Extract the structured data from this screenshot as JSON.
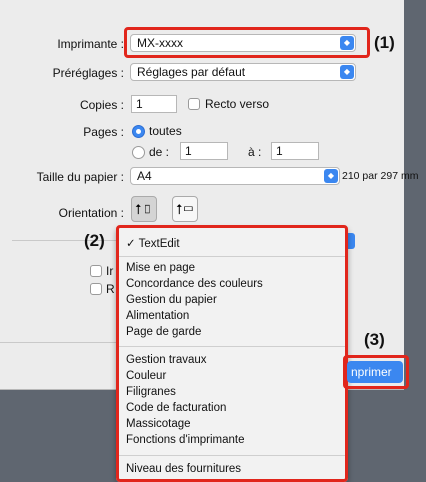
{
  "printer": {
    "label": "Imprimante :",
    "value": "MX-xxxx"
  },
  "presets": {
    "label": "Préréglages :",
    "value": "Réglages par défaut"
  },
  "copies": {
    "label": "Copies :",
    "value": "1",
    "duplex_label": "Recto verso"
  },
  "pages": {
    "label": "Pages :",
    "all_label": "toutes",
    "from_label": "de :",
    "from_value": "1",
    "to_label": "à :",
    "to_value": "1"
  },
  "paper": {
    "label": "Taille du papier :",
    "value": "A4",
    "dimensions": "210 par 297 mm"
  },
  "orientation": {
    "label": "Orientation :"
  },
  "callouts": {
    "c1": "(1)",
    "c2": "(2)",
    "c3": "(3)"
  },
  "hidden_options": {
    "opt1_fragment": "Ir",
    "opt2_fragment": "R"
  },
  "menu": {
    "checked": "✓ TextEdit",
    "group1": [
      "Mise en page",
      "Concordance des couleurs",
      "Gestion du papier",
      "Alimentation",
      "Page de garde"
    ],
    "group2": [
      "Gestion travaux",
      "Couleur",
      "Filigranes",
      "Code de facturation",
      "Massicotage",
      "Fonctions d'imprimante"
    ],
    "group3": [
      "Niveau des fournitures"
    ]
  },
  "print_button": {
    "label": "nprimer"
  },
  "colors": {
    "accent": "#3b87f0",
    "callout_border": "#e1261c",
    "dialog_bg": "#ececec"
  }
}
